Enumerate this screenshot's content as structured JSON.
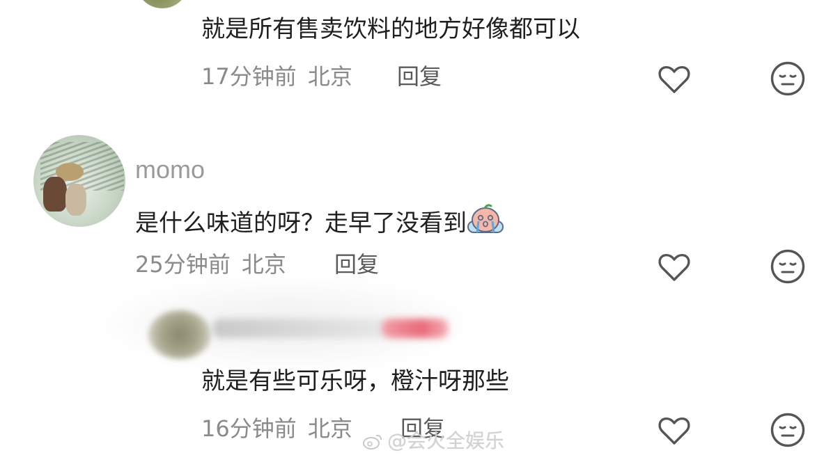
{
  "comments": [
    {
      "text": "就是所有售卖饮料的地方好像都可以",
      "time": "17分钟前",
      "location": "北京",
      "reply_label": "回复"
    },
    {
      "username": "momo",
      "text": "是什么味道的呀？走早了没看到",
      "time": "25分钟前",
      "location": "北京",
      "reply_label": "回复"
    },
    {
      "text": "就是有些可乐呀，橙汁呀那些",
      "time": "16分钟前",
      "location": "北京",
      "reply_label": "回复"
    }
  ],
  "icons": {
    "like": "heart-outline-icon",
    "dislike": "expressionless-face-icon",
    "emoji": "crying-face-emoji"
  },
  "watermark": {
    "text": "@会火全娱乐"
  },
  "colors": {
    "text": "#1f1f1f",
    "meta": "#8a8a8a",
    "icon": "#555555"
  }
}
